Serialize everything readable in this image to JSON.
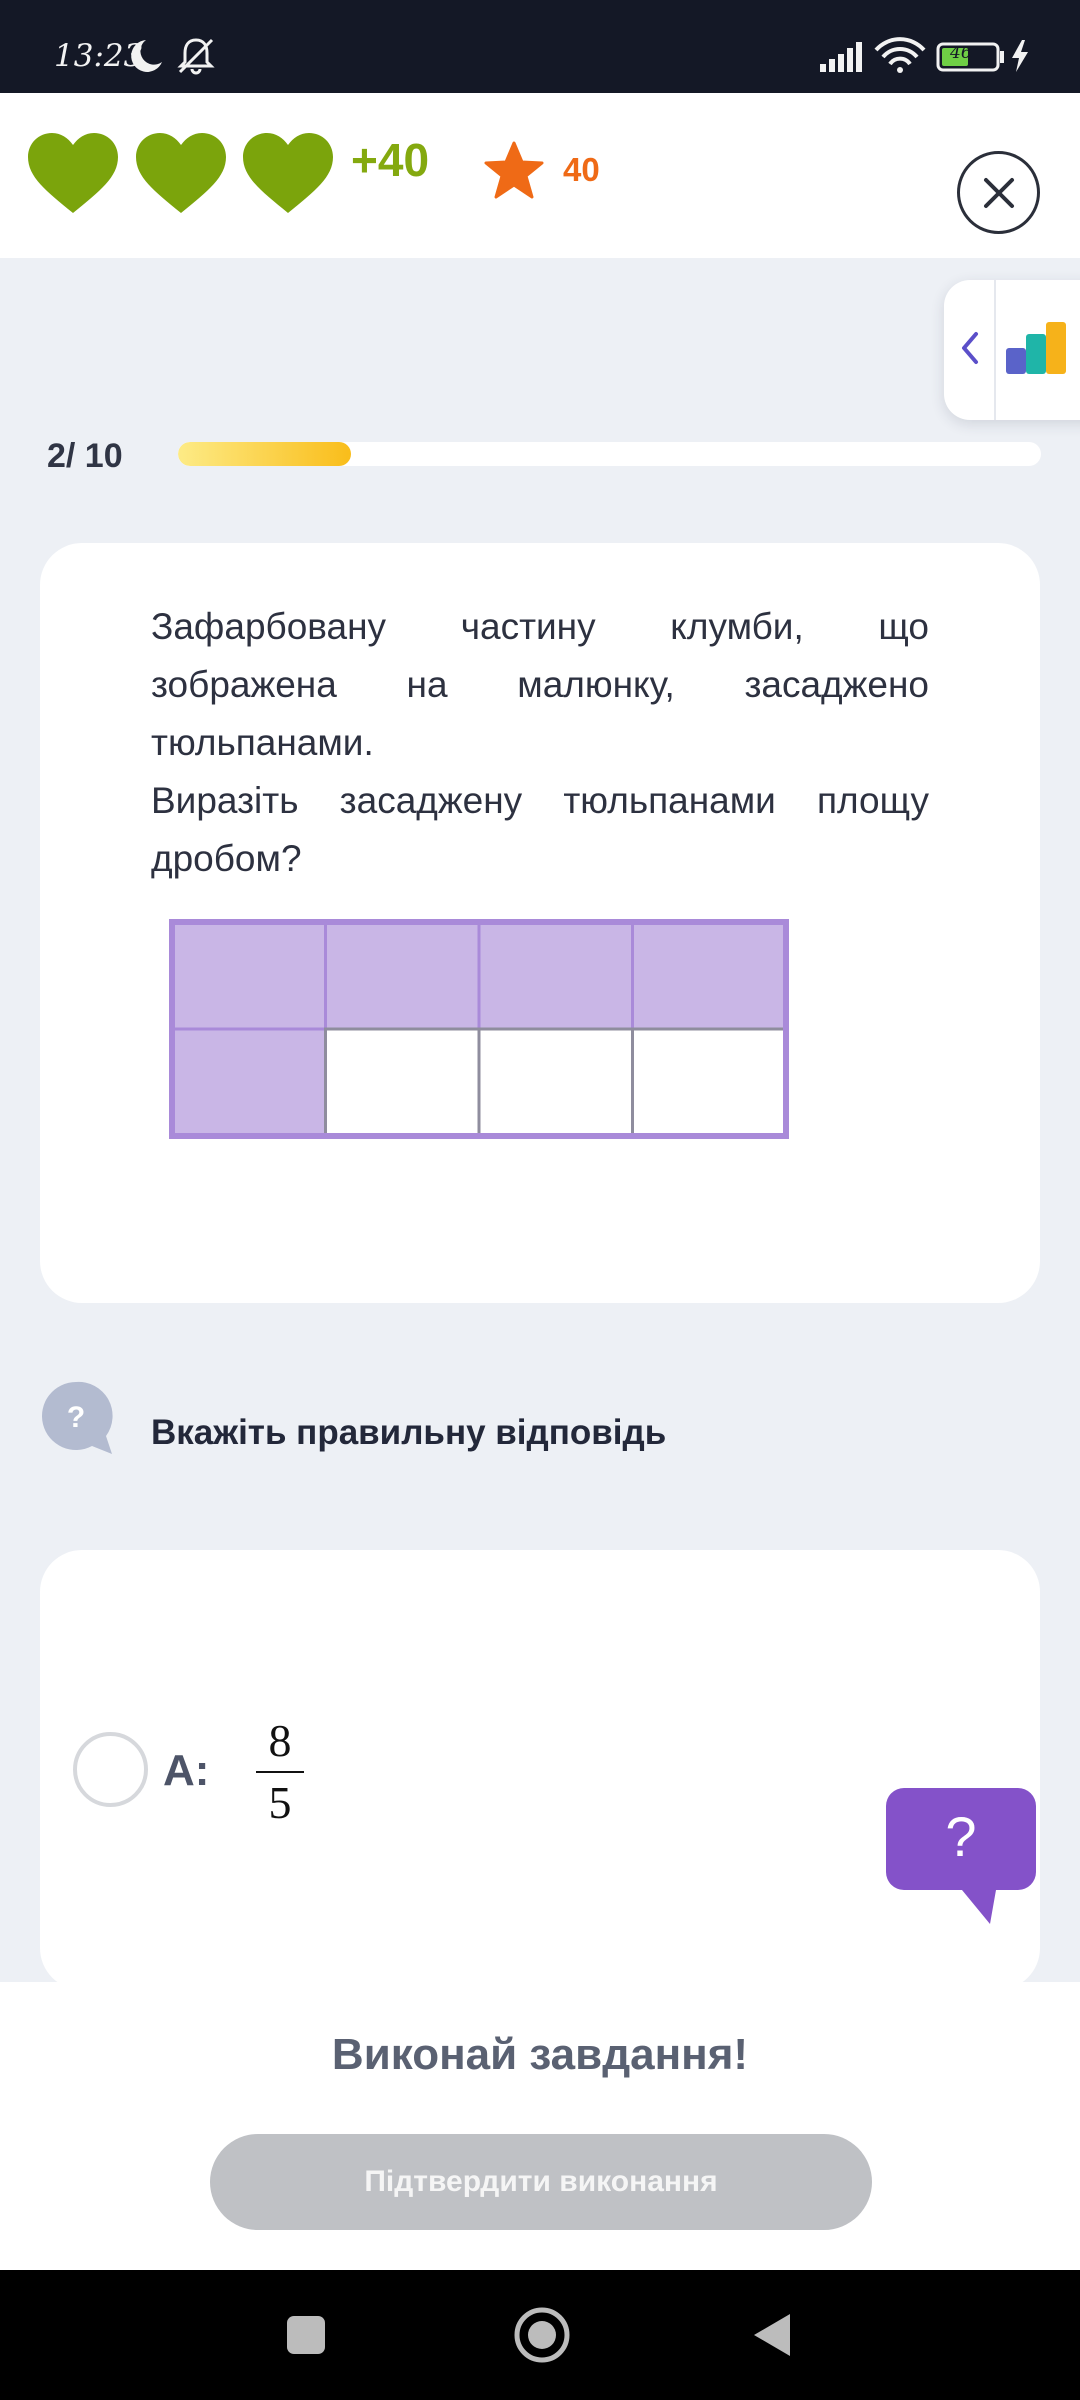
{
  "status_bar": {
    "time": "13:23",
    "battery_level": "46",
    "icons": [
      "moon-icon",
      "bell-off-icon",
      "signal-icon",
      "wifi-icon",
      "battery-icon",
      "charging-icon"
    ]
  },
  "header": {
    "lives": 3,
    "lives_bonus": "+40",
    "stars": "40",
    "colors": {
      "heart": "#7ba40c",
      "star": "#ef6a16"
    },
    "icons": [
      "heart-icon",
      "star-icon",
      "close-icon"
    ]
  },
  "side_panel": {
    "icons": [
      "chevron-left-icon",
      "bar-chart-icon"
    ]
  },
  "progress": {
    "label": "2/ 10",
    "fraction": 0.2
  },
  "question": {
    "line1": "Зафарбовану частину клумби, що зображена на малюнку, засаджено тюльпанами.",
    "line2": "Виразіть засаджену тюльпанами площу дробом?",
    "figure": {
      "rows": 2,
      "cols": 4,
      "shaded": [
        [
          true,
          true,
          true,
          true
        ],
        [
          true,
          false,
          false,
          false
        ]
      ],
      "shade_color": "#c9b6e6",
      "border_color": "#a98ad9"
    }
  },
  "hint": {
    "text": "Вкажіть правильну відповідь",
    "icon": "question-bubble-icon"
  },
  "answers": [
    {
      "letter": "A:",
      "numerator": "8",
      "denominator": "5"
    }
  ],
  "help_button": {
    "label": "?",
    "color": "#8452c9"
  },
  "bottom": {
    "title": "Виконай завдання!",
    "confirm_label": "Підтвердити виконання"
  },
  "nav_bar": {
    "icons": [
      "recent-apps-icon",
      "home-icon",
      "back-icon"
    ]
  }
}
